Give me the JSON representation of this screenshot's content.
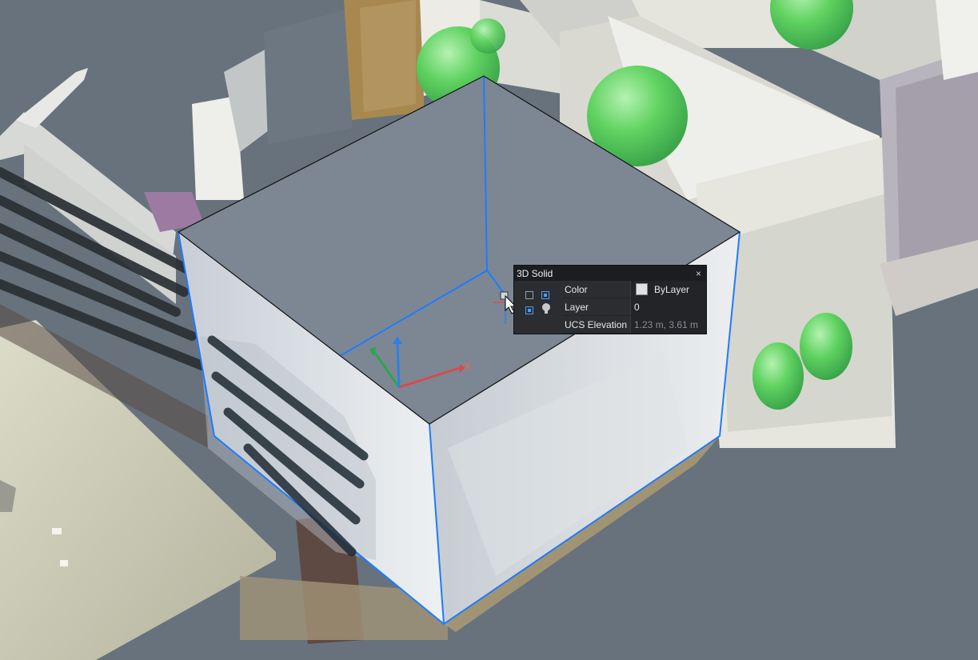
{
  "quad": {
    "title": "3D Solid",
    "close_glyph": "×",
    "properties": [
      {
        "label": "Color",
        "value": "ByLayer",
        "swatch": "#e1e1e1"
      },
      {
        "label": "Layer",
        "value": "0"
      },
      {
        "label": "UCS Elevation",
        "value": "1.23 m, 3.61 m"
      }
    ]
  },
  "ucs": {
    "x_label": "X"
  },
  "colors": {
    "selection": "#1e7bff",
    "background": "#67727d",
    "sphere_green": "#59d35c"
  }
}
